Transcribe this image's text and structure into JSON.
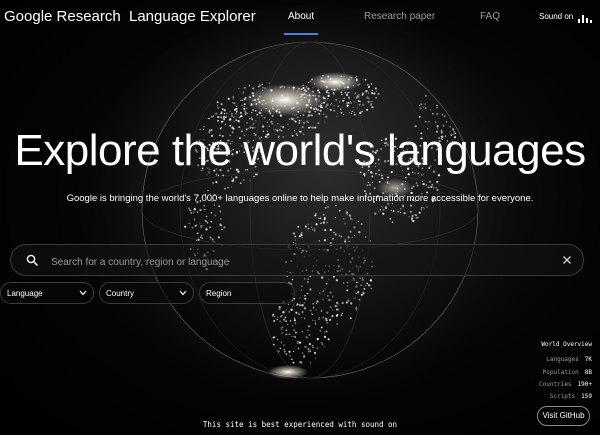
{
  "nav": {
    "brand": "Google Research",
    "app_title": "Language Explorer",
    "links": [
      {
        "label": "About",
        "active": true
      },
      {
        "label": "Research paper",
        "active": false
      },
      {
        "label": "FAQ",
        "active": false
      }
    ],
    "sound_label": "Sound on"
  },
  "hero": {
    "title": "Explore the world's languages",
    "subtitle": "Google is bringing the world's 7,000+ languages online to help make information more accessible for everyone."
  },
  "search": {
    "placeholder": "Search for a country, region or language",
    "value": ""
  },
  "filters": [
    {
      "label": "Language",
      "has_dropdown": true
    },
    {
      "label": "Country",
      "has_dropdown": true
    },
    {
      "label": "Region",
      "has_dropdown": false
    }
  ],
  "overview": {
    "title": "World Overview",
    "rows": [
      {
        "label": "Languages",
        "value": "7K"
      },
      {
        "label": "Population",
        "value": "8B"
      },
      {
        "label": "Countries",
        "value": "190+"
      },
      {
        "label": "Scripts",
        "value": "159"
      }
    ]
  },
  "github_label": "Visit GitHub",
  "footer_note": "This site is best experienced with sound on",
  "colors": {
    "background": "#000000",
    "accent": "#4d7fd8",
    "muted_text": "#9a9a9a"
  }
}
